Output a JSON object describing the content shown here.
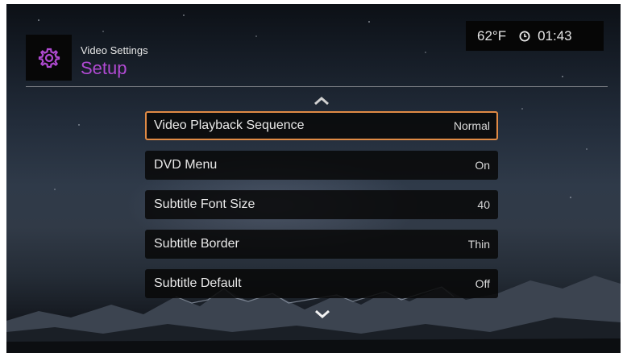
{
  "header": {
    "subtitle": "Video Settings",
    "title": "Setup",
    "icon": "gear-icon",
    "accent_color": "#b04ad2"
  },
  "status": {
    "temperature": "62°F",
    "clock_icon": "clock-icon",
    "time": "01:43"
  },
  "menu": {
    "selected_index": 0,
    "selected_border_color": "#e08a45",
    "items": [
      {
        "label": "Video Playback Sequence",
        "value": "Normal"
      },
      {
        "label": "DVD Menu",
        "value": "On"
      },
      {
        "label": "Subtitle Font Size",
        "value": "40"
      },
      {
        "label": "Subtitle Border",
        "value": "Thin"
      },
      {
        "label": "Subtitle Default",
        "value": "Off"
      }
    ]
  },
  "navigation": {
    "scroll_up_icon": "chevron-up-icon",
    "scroll_down_icon": "chevron-down-icon"
  }
}
